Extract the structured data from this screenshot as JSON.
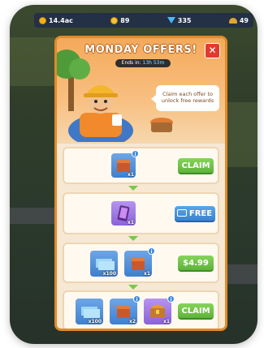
{
  "hud": {
    "coins": "14.4ac",
    "gold": "89",
    "gems": "335",
    "helmets": "49"
  },
  "offer": {
    "title": "MONDAY OFFERS!",
    "close_label": "✕",
    "timer_label": "Ends in:",
    "timer_value": "13h 53m",
    "bubble_text": "Claim each offer to unlock free rewards"
  },
  "rows": [
    {
      "items": [
        {
          "kind": "crate",
          "qty": "x1"
        }
      ],
      "action": "CLAIM"
    },
    {
      "items": [
        {
          "kind": "phone",
          "qty": "x1"
        }
      ],
      "action": "FREE"
    },
    {
      "items": [
        {
          "kind": "cash",
          "qty": "x100"
        },
        {
          "kind": "crate",
          "qty": "x1"
        }
      ],
      "action": "$4.99"
    },
    {
      "items": [
        {
          "kind": "cash",
          "qty": "x100"
        },
        {
          "kind": "crate",
          "qty": "x2"
        },
        {
          "kind": "chest",
          "qty": "x1"
        }
      ],
      "action": "CLAIM"
    }
  ],
  "colors": {
    "panel_border": "#e28a2a",
    "claim_green": "#6cc243",
    "free_blue": "#3a82cf",
    "close_red": "#e23b2e"
  }
}
